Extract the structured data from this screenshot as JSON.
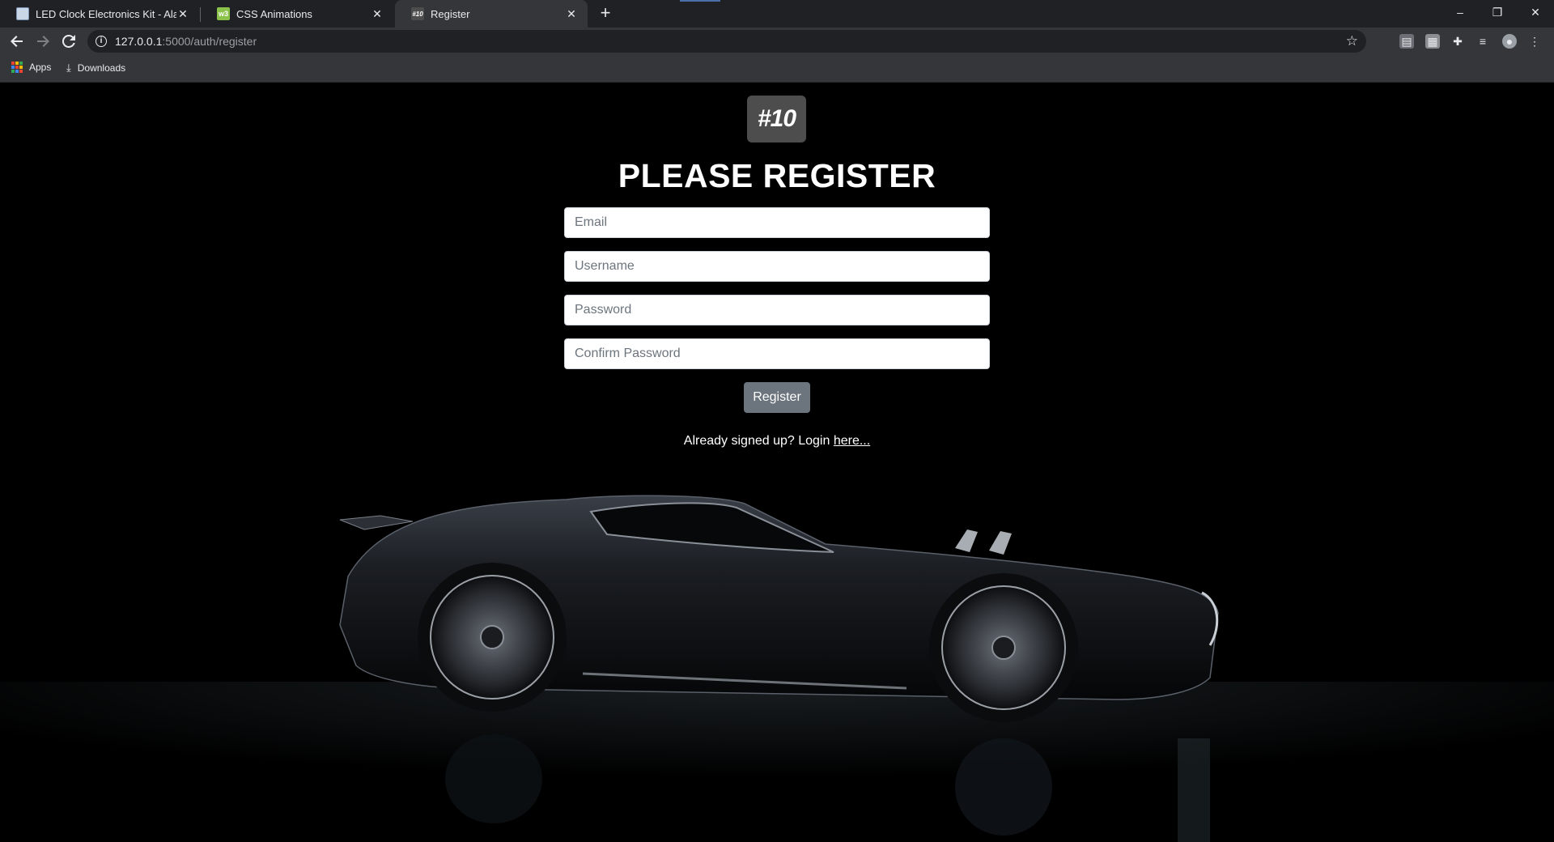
{
  "browser": {
    "tabs": [
      {
        "title": "LED Clock Electronics Kit - Alarm",
        "active": false
      },
      {
        "title": "CSS Animations",
        "active": false
      },
      {
        "title": "Register",
        "active": true
      }
    ],
    "favicon_labels": {
      "register": "#10"
    },
    "new_tab_glyph": "+",
    "close_glyph": "✕",
    "window_controls": {
      "minimize": "–",
      "restore": "❐",
      "close": "✕"
    },
    "address": {
      "host": "127.0.0.1",
      "rest": ":5000/auth/register"
    },
    "bookmarks": [
      {
        "label": "Apps",
        "icon": "apps-grid-icon"
      },
      {
        "label": "Downloads",
        "icon": "download-icon"
      }
    ]
  },
  "page": {
    "logo_text": "#10",
    "heading": "PLEASE REGISTER",
    "fields": {
      "email": {
        "placeholder": "Email",
        "value": ""
      },
      "username": {
        "placeholder": "Username",
        "value": ""
      },
      "password": {
        "placeholder": "Password",
        "value": ""
      },
      "confirm_password": {
        "placeholder": "Confirm Password",
        "value": ""
      }
    },
    "register_button": "Register",
    "login_prompt": "Already signed up? Login",
    "login_link": "here..."
  },
  "colors": {
    "background": "#000000",
    "chrome_dark": "#202124",
    "chrome_light": "#35363a",
    "button": "#6c757d"
  }
}
